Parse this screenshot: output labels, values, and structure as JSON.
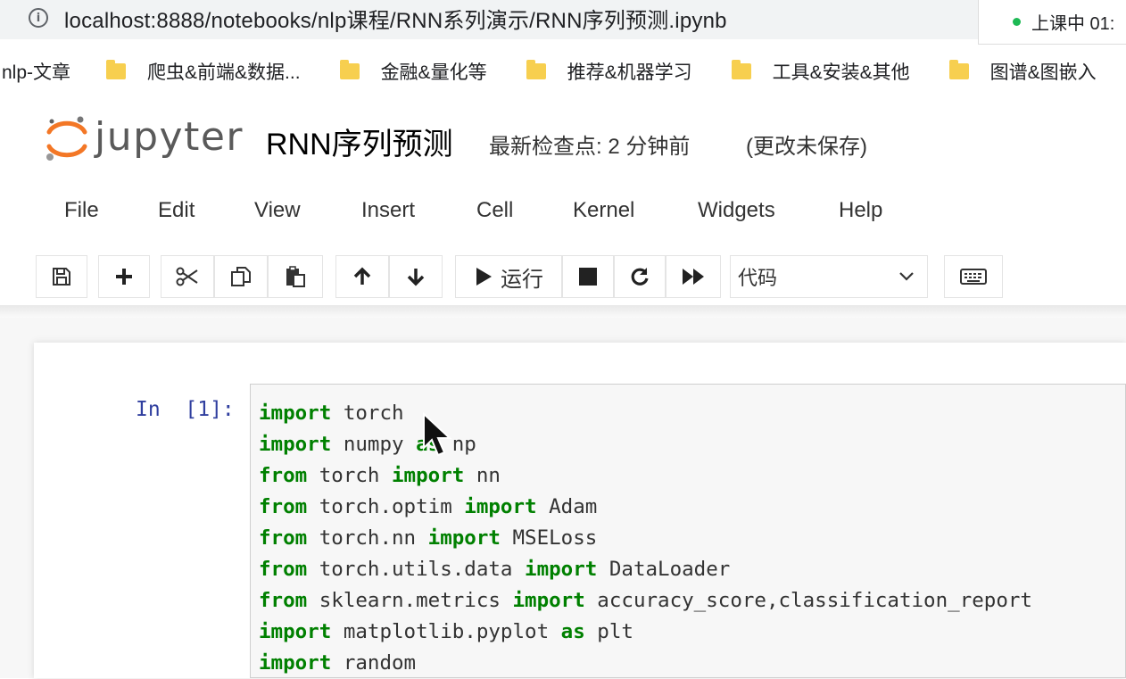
{
  "browser": {
    "url": "localhost:8888/notebooks/nlp课程/RNN系列演示/RNN序列预测.ipynb",
    "status_text": "上课中 01:"
  },
  "bookmarks": [
    {
      "label": "nlp-文章",
      "icon": "none"
    },
    {
      "label": "爬虫&前端&数据...",
      "icon": "folder-icon"
    },
    {
      "label": "金融&量化等",
      "icon": "folder-icon"
    },
    {
      "label": "推荐&机器学习",
      "icon": "folder-icon"
    },
    {
      "label": "工具&安装&其他",
      "icon": "folder-icon"
    },
    {
      "label": "图谱&图嵌入",
      "icon": "folder-icon"
    }
  ],
  "header": {
    "logo_text": "jupyter",
    "notebook_title": "RNN序列预测",
    "checkpoint": "最新检查点: 2 分钟前",
    "unsaved": "(更改未保存)"
  },
  "menu": [
    "File",
    "Edit",
    "View",
    "Insert",
    "Cell",
    "Kernel",
    "Widgets",
    "Help"
  ],
  "toolbar": {
    "run_label": "运行",
    "cell_type": "代码",
    "icons": [
      "save-icon",
      "plus-icon",
      "cut-icon",
      "copy-icon",
      "paste-icon",
      "arrow-up-icon",
      "arrow-down-icon",
      "play-icon",
      "stop-icon",
      "restart-icon",
      "fast-forward-icon",
      "keyboard-icon"
    ]
  },
  "cell": {
    "prompt": "In  [1]:",
    "lines": [
      [
        [
          "kw",
          "import"
        ],
        [
          "t",
          " torch"
        ]
      ],
      [
        [
          "kw",
          "import"
        ],
        [
          "t",
          " numpy "
        ],
        [
          "kw",
          "as"
        ],
        [
          "t",
          " np"
        ]
      ],
      [
        [
          "kw",
          "from"
        ],
        [
          "t",
          " torch "
        ],
        [
          "kw",
          "import"
        ],
        [
          "t",
          " nn"
        ]
      ],
      [
        [
          "kw",
          "from"
        ],
        [
          "t",
          " torch.optim "
        ],
        [
          "kw",
          "import"
        ],
        [
          "t",
          " Adam"
        ]
      ],
      [
        [
          "kw",
          "from"
        ],
        [
          "t",
          " torch.nn "
        ],
        [
          "kw",
          "import"
        ],
        [
          "t",
          " MSELoss"
        ]
      ],
      [
        [
          "kw",
          "from"
        ],
        [
          "t",
          " torch.utils.data "
        ],
        [
          "kw",
          "import"
        ],
        [
          "t",
          " DataLoader"
        ]
      ],
      [
        [
          "kw",
          "from"
        ],
        [
          "t",
          " sklearn.metrics "
        ],
        [
          "kw",
          "import"
        ],
        [
          "t",
          " accuracy_score,classification_report"
        ]
      ],
      [
        [
          "kw",
          "import"
        ],
        [
          "t",
          " matplotlib.pyplot "
        ],
        [
          "kw",
          "as"
        ],
        [
          "t",
          " plt"
        ]
      ],
      [
        [
          "kw",
          "import"
        ],
        [
          "t",
          " random"
        ]
      ]
    ]
  },
  "colors": {
    "keyword": "#008000",
    "prompt": "#303f9f",
    "logo_orange": "#f37726"
  }
}
